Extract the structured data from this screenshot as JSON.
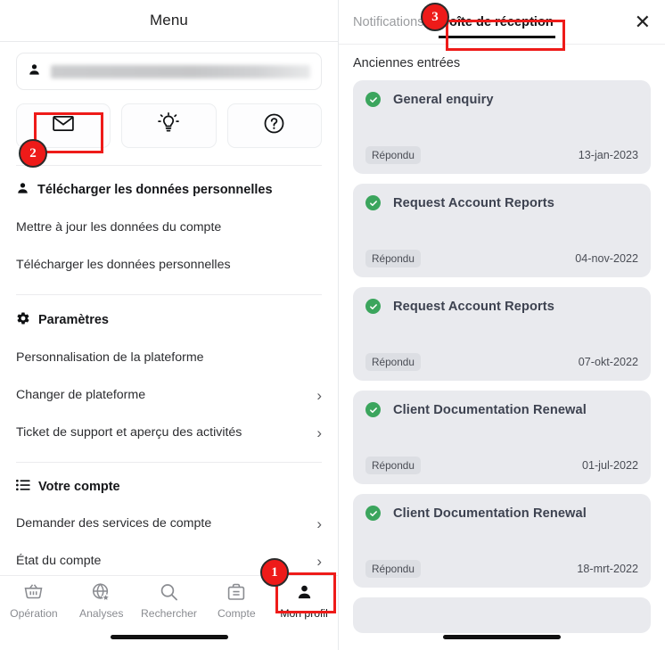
{
  "left": {
    "title": "Menu",
    "profile": {
      "icon": "person-icon",
      "value": ""
    },
    "quick_actions": [
      {
        "name": "mail-icon",
        "glyph": "mail"
      },
      {
        "name": "lightbulb-icon",
        "glyph": "bulb"
      },
      {
        "name": "help-circle-icon",
        "glyph": "help"
      }
    ],
    "sections": [
      {
        "icon": "person-icon",
        "header": "Télécharger les données personnelles",
        "items": [
          {
            "label": "Mettre à jour les données du compte",
            "chevron": false
          },
          {
            "label": "Télécharger les données personnelles",
            "chevron": false
          }
        ]
      },
      {
        "icon": "gear-icon",
        "header": "Paramètres",
        "items": [
          {
            "label": "Personnalisation de la plateforme",
            "chevron": false
          },
          {
            "label": "Changer de plateforme",
            "chevron": true
          },
          {
            "label": "Ticket de support et aperçu des activités",
            "chevron": true
          }
        ]
      },
      {
        "icon": "list-icon",
        "header": "Votre compte",
        "items": [
          {
            "label": "Demander des services de compte",
            "chevron": true
          },
          {
            "label": "État du compte",
            "chevron": true
          }
        ]
      }
    ],
    "tabbar": [
      {
        "icon": "basket-icon",
        "label": "Opération",
        "active": false
      },
      {
        "icon": "globe-star-icon",
        "label": "Analyses",
        "active": false
      },
      {
        "icon": "search-icon",
        "label": "Rechercher",
        "active": false
      },
      {
        "icon": "briefcase-icon",
        "label": "Compte",
        "active": false
      },
      {
        "icon": "person-icon",
        "label": "Mon profil",
        "active": true
      }
    ]
  },
  "right": {
    "tabs": [
      {
        "label": "Notifications",
        "selected": false
      },
      {
        "label": "Boîte de réception",
        "selected": true
      }
    ],
    "close_icon": "close-icon",
    "list_title": "Anciennes entrées",
    "cards": [
      {
        "status_icon": "check-circle-icon",
        "title": "General enquiry",
        "status": "Répondu",
        "date": "13-jan-2023"
      },
      {
        "status_icon": "check-circle-icon",
        "title": "Request Account Reports",
        "status": "Répondu",
        "date": "04-nov-2022"
      },
      {
        "status_icon": "check-circle-icon",
        "title": "Request Account Reports",
        "status": "Répondu",
        "date": "07-okt-2022"
      },
      {
        "status_icon": "check-circle-icon",
        "title": "Client Documentation Renewal",
        "status": "Répondu",
        "date": "01-jul-2022"
      },
      {
        "status_icon": "check-circle-icon",
        "title": "Client Documentation Renewal",
        "status": "Répondu",
        "date": "18-mrt-2022"
      }
    ]
  },
  "annotations": {
    "color": "#ee1b19",
    "markers": [
      {
        "number": "1",
        "target": "tabbar-mon-profil"
      },
      {
        "number": "2",
        "target": "quick-action-mail"
      },
      {
        "number": "3",
        "target": "tab-boite-de-reception"
      }
    ]
  }
}
